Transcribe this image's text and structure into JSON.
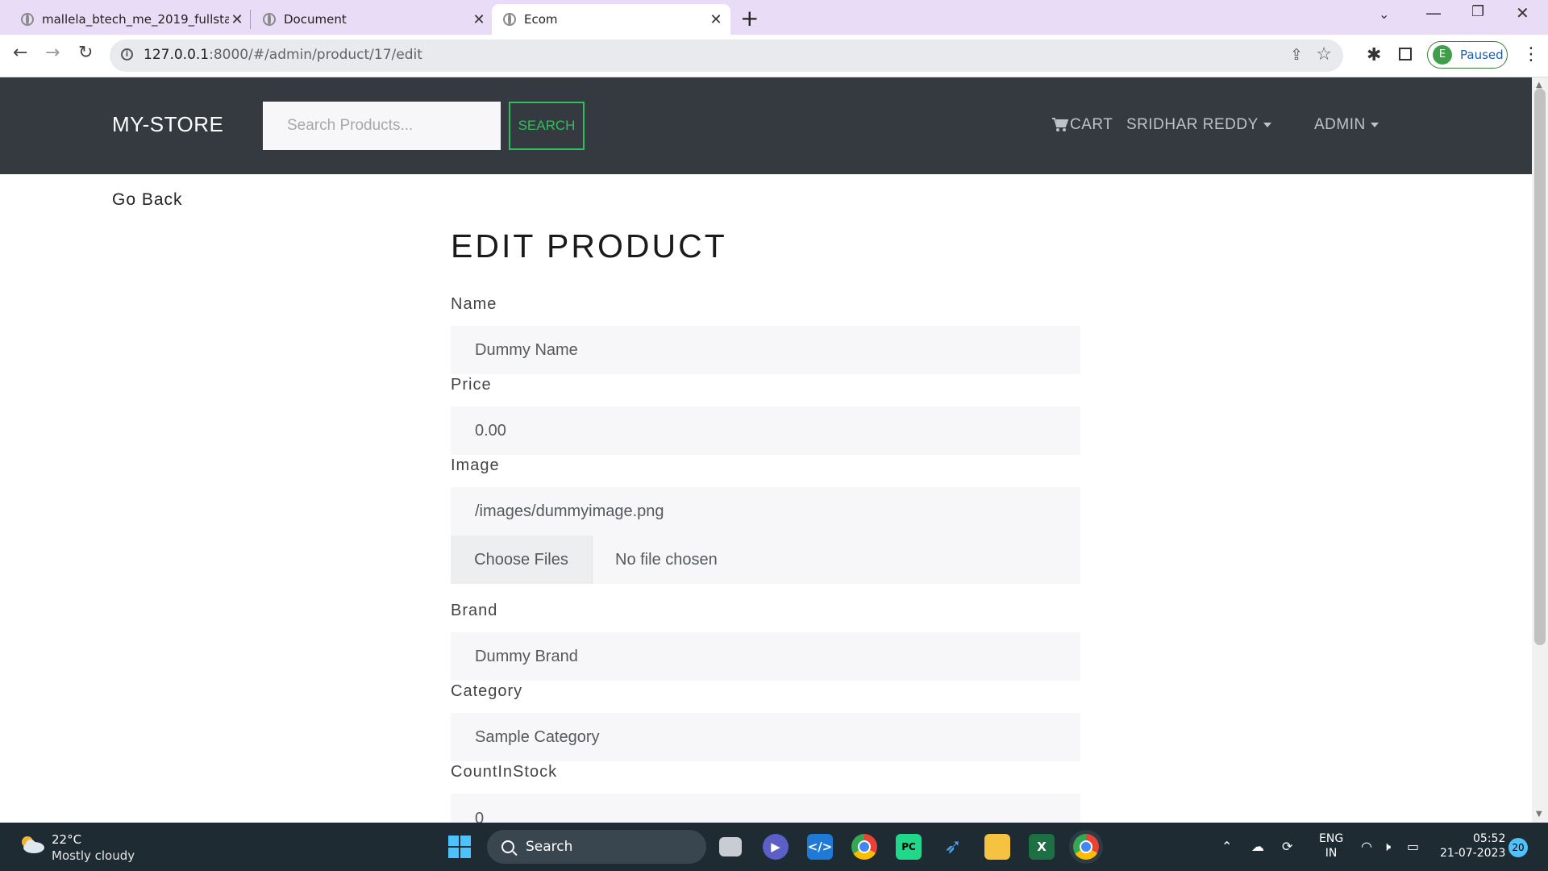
{
  "browser": {
    "tabs": [
      {
        "title": "mallela_btech_me_2019_fullstack"
      },
      {
        "title": "Document"
      },
      {
        "title": "Ecom"
      }
    ],
    "url_host": "127.0.0.1",
    "url_rest": ":8000/#/admin/product/17/edit",
    "profile_initial": "E",
    "profile_status": "Paused"
  },
  "navbar": {
    "brand": "MY-STORE",
    "search_placeholder": "Search Products...",
    "search_button": "SEARCH",
    "cart": "CART",
    "user": "SRIDHAR REDDY",
    "admin": "ADMIN"
  },
  "page": {
    "go_back": "Go Back",
    "title": "EDIT PRODUCT",
    "fields": {
      "name": {
        "label": "Name",
        "value": "Dummy Name"
      },
      "price": {
        "label": "Price",
        "value": "0.00"
      },
      "image": {
        "label": "Image",
        "value": "/images/dummyimage.png",
        "file_button": "Choose Files",
        "file_status": "No file chosen"
      },
      "brand": {
        "label": "Brand",
        "value": "Dummy Brand"
      },
      "category": {
        "label": "Category",
        "value": "Sample Category"
      },
      "count": {
        "label": "CountInStock",
        "value": "0"
      }
    }
  },
  "taskbar": {
    "temperature": "22°C",
    "weather": "Mostly cloudy",
    "search": "Search",
    "lang_line1": "ENG",
    "lang_line2": "IN",
    "time": "05:52",
    "date": "21-07-2023",
    "notifications": "20"
  }
}
